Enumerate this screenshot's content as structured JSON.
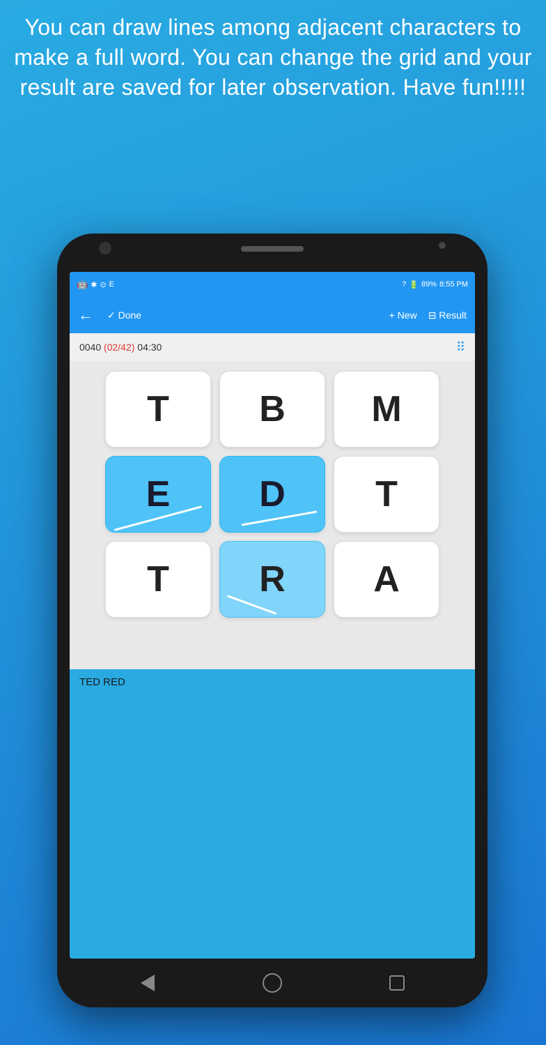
{
  "header": {
    "text": "You can draw lines among adjacent characters to make a full word. You can change the grid and your result are saved for later observation. Have fun!!!!!"
  },
  "status_bar": {
    "bluetooth": "✱",
    "alarm": "⊙",
    "signal": "E",
    "lock": "?",
    "battery_pct": "89%",
    "time": "8:55 PM"
  },
  "toolbar": {
    "back_icon": "←",
    "done_label": "✓ Done",
    "new_label": "+ New",
    "result_label": "⊟ Result"
  },
  "info_bar": {
    "number": "0040",
    "progress": "(02/42)",
    "timer": "04:30",
    "grid_icon": "⠿"
  },
  "grid": {
    "cells": [
      [
        {
          "letter": "T",
          "selected": false
        },
        {
          "letter": "B",
          "selected": false
        },
        {
          "letter": "M",
          "selected": false
        }
      ],
      [
        {
          "letter": "E",
          "selected": true,
          "line": true
        },
        {
          "letter": "D",
          "selected": true,
          "line": true
        },
        {
          "letter": "T",
          "selected": false
        }
      ],
      [
        {
          "letter": "T",
          "selected": false
        },
        {
          "letter": "R",
          "selected": true
        },
        {
          "letter": "A",
          "selected": false
        }
      ]
    ]
  },
  "words_found": {
    "words": "TED   RED"
  },
  "nav": {
    "back_label": "◁",
    "home_label": "○",
    "recent_label": "□"
  }
}
